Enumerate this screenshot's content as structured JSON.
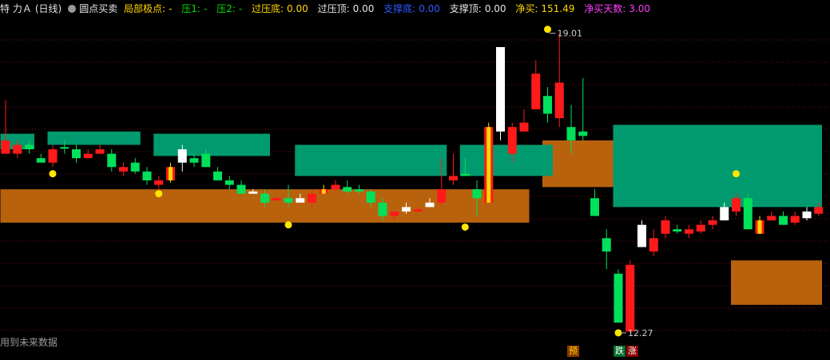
{
  "header": {
    "stock_name": "特 力Ａ",
    "period": "(日线)",
    "indicator_name": "圆点买卖",
    "local_extreme_label": "局部极点:",
    "local_extreme_value": "-",
    "resist1_label": "压1:",
    "resist1_value": "-",
    "resist2_label": "压2:",
    "resist2_value": "-",
    "over_resist_bottom_label": "过压底:",
    "over_resist_bottom_value": "0.00",
    "over_resist_top_label": "过压顶:",
    "over_resist_top_value": "0.00",
    "support_bottom_label": "支撑底:",
    "support_bottom_value": "0.00",
    "support_top_label": "支撑顶:",
    "support_top_value": "0.00",
    "net_buy_label": "净买:",
    "net_buy_value": "151.49",
    "net_buy_days_label": "净买天数:",
    "net_buy_days_value": "3.00"
  },
  "footer_note": "用到未来数据",
  "signals": {
    "yu": "预",
    "die": "跌",
    "zhang": "涨"
  },
  "colors": {
    "background": "#000000",
    "up": "#ff1a1a",
    "down": "#00e05a",
    "neutral": "#ffffff",
    "special": "#ffd700",
    "zone_green": "#009a6e",
    "zone_orange": "#b8620e",
    "grid": "#7a1010",
    "dot": "#ffe600"
  },
  "chart_data": {
    "type": "candlestick",
    "price_range": [
      12.0,
      19.4
    ],
    "price_labels": [
      {
        "text": "19.01",
        "price": 19.01,
        "index": 46
      },
      {
        "text": "12.27",
        "price": 12.27,
        "index": 52
      }
    ],
    "candles": [
      {
        "o": 16.6,
        "h": 17.5,
        "l": 16.4,
        "c": 16.3,
        "color": "up"
      },
      {
        "o": 16.5,
        "h": 16.6,
        "l": 16.2,
        "c": 16.3,
        "color": "up"
      },
      {
        "o": 16.5,
        "h": 16.6,
        "l": 16.3,
        "c": 16.4,
        "color": "down"
      },
      {
        "o": 16.2,
        "h": 16.3,
        "l": 16.1,
        "c": 16.1,
        "color": "down"
      },
      {
        "o": 16.4,
        "h": 16.5,
        "l": 16.0,
        "c": 16.1,
        "color": "up"
      },
      {
        "o": 16.45,
        "h": 16.6,
        "l": 16.3,
        "c": 16.45,
        "color": "down"
      },
      {
        "o": 16.4,
        "h": 16.5,
        "l": 16.1,
        "c": 16.2,
        "color": "down"
      },
      {
        "o": 16.3,
        "h": 16.4,
        "l": 16.2,
        "c": 16.2,
        "color": "up"
      },
      {
        "o": 16.4,
        "h": 16.5,
        "l": 16.3,
        "c": 16.3,
        "color": "up"
      },
      {
        "o": 16.3,
        "h": 16.4,
        "l": 15.9,
        "c": 16.0,
        "color": "down"
      },
      {
        "o": 16.0,
        "h": 16.1,
        "l": 15.8,
        "c": 15.9,
        "color": "up"
      },
      {
        "o": 16.1,
        "h": 16.2,
        "l": 15.85,
        "c": 15.9,
        "color": "down"
      },
      {
        "o": 15.9,
        "h": 16.0,
        "l": 15.6,
        "c": 15.7,
        "color": "down"
      },
      {
        "o": 15.6,
        "h": 15.8,
        "l": 15.5,
        "c": 15.7,
        "color": "up"
      },
      {
        "o": 16.0,
        "h": 16.1,
        "l": 15.65,
        "c": 15.7,
        "color": "special"
      },
      {
        "o": 16.4,
        "h": 16.5,
        "l": 15.9,
        "c": 16.1,
        "color": "neutral"
      },
      {
        "o": 16.2,
        "h": 16.3,
        "l": 16.0,
        "c": 16.1,
        "color": "down"
      },
      {
        "o": 16.3,
        "h": 16.4,
        "l": 16.0,
        "c": 16.0,
        "color": "down"
      },
      {
        "o": 15.9,
        "h": 16.0,
        "l": 15.7,
        "c": 15.7,
        "color": "down"
      },
      {
        "o": 15.7,
        "h": 15.8,
        "l": 15.5,
        "c": 15.6,
        "color": "down"
      },
      {
        "o": 15.6,
        "h": 15.7,
        "l": 15.4,
        "c": 15.4,
        "color": "down"
      },
      {
        "o": 15.45,
        "h": 15.5,
        "l": 15.4,
        "c": 15.4,
        "color": "neutral"
      },
      {
        "o": 15.4,
        "h": 15.5,
        "l": 15.1,
        "c": 15.2,
        "color": "down"
      },
      {
        "o": 15.3,
        "h": 15.35,
        "l": 15.25,
        "c": 15.25,
        "color": "up"
      },
      {
        "o": 15.3,
        "h": 15.6,
        "l": 15.1,
        "c": 15.2,
        "color": "down"
      },
      {
        "o": 15.3,
        "h": 15.4,
        "l": 15.2,
        "c": 15.2,
        "color": "neutral"
      },
      {
        "o": 15.4,
        "h": 15.5,
        "l": 15.1,
        "c": 15.2,
        "color": "up"
      },
      {
        "o": 15.5,
        "h": 15.6,
        "l": 15.4,
        "c": 15.4,
        "color": "special"
      },
      {
        "o": 15.6,
        "h": 15.7,
        "l": 15.45,
        "c": 15.5,
        "color": "up"
      },
      {
        "o": 15.55,
        "h": 15.7,
        "l": 15.4,
        "c": 15.45,
        "color": "down"
      },
      {
        "o": 15.5,
        "h": 15.6,
        "l": 15.4,
        "c": 15.45,
        "color": "down"
      },
      {
        "o": 15.45,
        "h": 15.5,
        "l": 15.1,
        "c": 15.2,
        "color": "down"
      },
      {
        "o": 15.2,
        "h": 15.3,
        "l": 14.8,
        "c": 14.9,
        "color": "down"
      },
      {
        "o": 14.9,
        "h": 15.0,
        "l": 14.8,
        "c": 15.0,
        "color": "up"
      },
      {
        "o": 15.1,
        "h": 15.2,
        "l": 14.95,
        "c": 15.0,
        "color": "neutral"
      },
      {
        "o": 15.05,
        "h": 15.1,
        "l": 15.0,
        "c": 15.0,
        "color": "up"
      },
      {
        "o": 15.2,
        "h": 15.3,
        "l": 15.1,
        "c": 15.1,
        "color": "neutral"
      },
      {
        "o": 15.2,
        "h": 16.2,
        "l": 15.1,
        "c": 15.5,
        "color": "up"
      },
      {
        "o": 15.8,
        "h": 16.3,
        "l": 15.6,
        "c": 15.7,
        "color": "up"
      },
      {
        "o": 15.85,
        "h": 16.2,
        "l": 15.8,
        "c": 15.8,
        "color": "down"
      },
      {
        "o": 15.5,
        "h": 15.7,
        "l": 14.9,
        "c": 15.3,
        "color": "down"
      },
      {
        "o": 16.9,
        "h": 17.0,
        "l": 15.2,
        "c": 15.2,
        "color": "special"
      },
      {
        "o": 16.8,
        "h": 18.7,
        "l": 16.6,
        "c": 18.7,
        "color": "neutral"
      },
      {
        "o": 16.9,
        "h": 17.0,
        "l": 16.1,
        "c": 16.3,
        "color": "up"
      },
      {
        "o": 17.0,
        "h": 17.3,
        "l": 16.8,
        "c": 16.8,
        "color": "up"
      },
      {
        "o": 18.1,
        "h": 18.4,
        "l": 17.3,
        "c": 17.3,
        "color": "up"
      },
      {
        "o": 17.6,
        "h": 17.8,
        "l": 17.0,
        "c": 17.2,
        "color": "down"
      },
      {
        "o": 17.9,
        "h": 19.01,
        "l": 16.9,
        "c": 17.1,
        "color": "up"
      },
      {
        "o": 16.9,
        "h": 17.4,
        "l": 16.3,
        "c": 16.6,
        "color": "down"
      },
      {
        "o": 16.8,
        "h": 18.0,
        "l": 16.6,
        "c": 16.7,
        "color": "down"
      },
      {
        "o": 15.3,
        "h": 15.5,
        "l": 14.9,
        "c": 14.9,
        "color": "down"
      },
      {
        "o": 14.4,
        "h": 14.6,
        "l": 13.7,
        "c": 14.1,
        "color": "down"
      },
      {
        "o": 13.6,
        "h": 13.7,
        "l": 12.5,
        "c": 12.5,
        "color": "down"
      },
      {
        "o": 13.8,
        "h": 13.9,
        "l": 12.27,
        "c": 12.3,
        "color": "up"
      },
      {
        "o": 14.7,
        "h": 14.8,
        "l": 14.2,
        "c": 14.2,
        "color": "neutral"
      },
      {
        "o": 14.4,
        "h": 14.6,
        "l": 14.0,
        "c": 14.1,
        "color": "up"
      },
      {
        "o": 14.8,
        "h": 14.9,
        "l": 14.4,
        "c": 14.5,
        "color": "up"
      },
      {
        "o": 14.6,
        "h": 14.7,
        "l": 14.5,
        "c": 14.55,
        "color": "down"
      },
      {
        "o": 14.6,
        "h": 14.7,
        "l": 14.4,
        "c": 14.5,
        "color": "up"
      },
      {
        "o": 14.7,
        "h": 14.8,
        "l": 14.5,
        "c": 14.55,
        "color": "up"
      },
      {
        "o": 14.8,
        "h": 14.9,
        "l": 14.6,
        "c": 14.7,
        "color": "up"
      },
      {
        "o": 15.1,
        "h": 15.2,
        "l": 14.8,
        "c": 14.8,
        "color": "neutral"
      },
      {
        "o": 15.3,
        "h": 15.4,
        "l": 14.9,
        "c": 15.0,
        "color": "up"
      },
      {
        "o": 15.3,
        "h": 15.4,
        "l": 14.6,
        "c": 14.6,
        "color": "down"
      },
      {
        "o": 14.8,
        "h": 14.9,
        "l": 14.5,
        "c": 14.5,
        "color": "special"
      },
      {
        "o": 14.9,
        "h": 15.0,
        "l": 14.8,
        "c": 14.8,
        "color": "up"
      },
      {
        "o": 14.9,
        "h": 15.0,
        "l": 14.7,
        "c": 14.7,
        "color": "down"
      },
      {
        "o": 14.9,
        "h": 15.0,
        "l": 14.7,
        "c": 14.75,
        "color": "up"
      },
      {
        "o": 15.0,
        "h": 15.1,
        "l": 14.8,
        "c": 14.85,
        "color": "neutral"
      },
      {
        "o": 15.1,
        "h": 15.2,
        "l": 14.9,
        "c": 14.95,
        "color": "up"
      }
    ],
    "zones": [
      {
        "color": "zone_green",
        "i0": 0,
        "i1": 2,
        "p_top": 16.75,
        "p_bottom": 16.4
      },
      {
        "color": "zone_green",
        "i0": 4,
        "i1": 11,
        "p_top": 16.8,
        "p_bottom": 16.5
      },
      {
        "color": "zone_green",
        "i0": 13,
        "i1": 22,
        "p_top": 16.75,
        "p_bottom": 16.25
      },
      {
        "color": "zone_green",
        "i0": 25,
        "i1": 37,
        "p_top": 16.5,
        "p_bottom": 15.8
      },
      {
        "color": "zone_green",
        "i0": 39,
        "i1": 46,
        "p_top": 16.5,
        "p_bottom": 15.8
      },
      {
        "color": "zone_green",
        "i0": 52,
        "i1": 69,
        "p_top": 16.95,
        "p_bottom": 15.1
      },
      {
        "color": "zone_orange",
        "i0": 0,
        "i1": 44,
        "p_top": 15.5,
        "p_bottom": 14.75
      },
      {
        "color": "zone_orange",
        "i0": 46,
        "i1": 60,
        "p_top": 16.6,
        "p_bottom": 15.55
      },
      {
        "color": "zone_orange",
        "i0": 62,
        "i1": 69,
        "p_top": 13.9,
        "p_bottom": 12.9
      }
    ],
    "dots": [
      {
        "i": 4,
        "price": 15.85
      },
      {
        "i": 13,
        "price": 15.4
      },
      {
        "i": 24,
        "price": 14.7
      },
      {
        "i": 39,
        "price": 14.65
      },
      {
        "i": 46,
        "price": 19.1
      },
      {
        "i": 52,
        "price": 12.27
      },
      {
        "i": 62,
        "price": 15.85
      }
    ]
  }
}
